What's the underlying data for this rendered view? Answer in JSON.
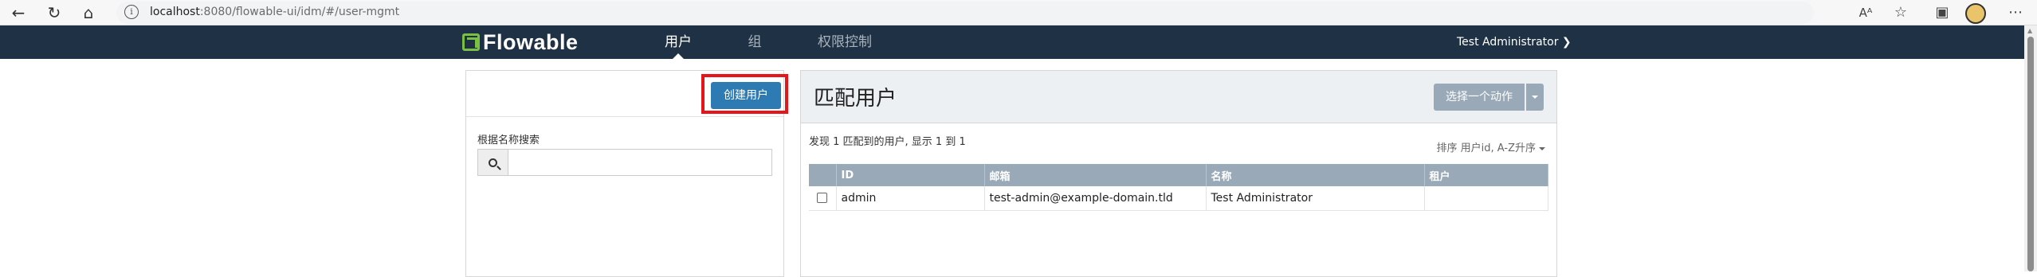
{
  "browser": {
    "url_host": "localhost",
    "url_path": ":8080/flowable-ui/idm/#/user-mgmt"
  },
  "app": {
    "logo_text": "Flowable",
    "nav": {
      "users": "用户",
      "groups": "组",
      "privileges": "权限控制"
    },
    "user_menu": "Test Administrator"
  },
  "left_panel": {
    "create_button": "创建用户",
    "search_label": "根据名称搜索",
    "search_value": ""
  },
  "right_panel": {
    "title": "匹配用户",
    "action_button": "选择一个动作",
    "found_text": "发现 1 匹配到的用户, 显示 1 到 1",
    "sort_text": "排序 用户id, A-Z升序",
    "table": {
      "headers": [
        "ID",
        "邮箱",
        "名称",
        "租户"
      ],
      "rows": [
        {
          "id": "admin",
          "email": "test-admin@example-domain.tld",
          "name": "Test Administrator",
          "tenant": ""
        }
      ]
    }
  },
  "colors": {
    "navbar": "#1f3245",
    "primary_button": "#2e7bb4",
    "table_header": "#9aa9b8",
    "highlight_box": "#e6141b",
    "logo_green": "#7ac143"
  }
}
